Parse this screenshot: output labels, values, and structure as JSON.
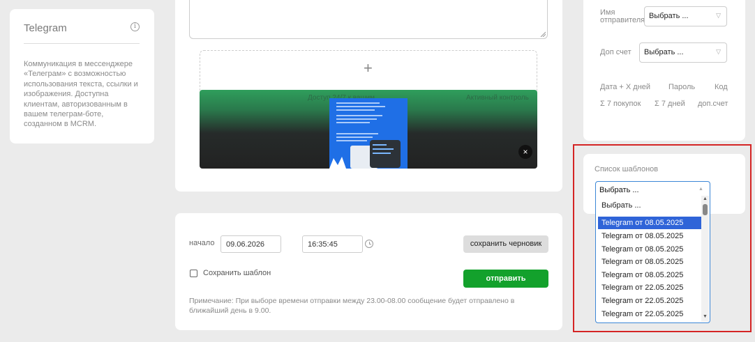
{
  "telegram_card": {
    "title": "Telegram",
    "description": "Коммуникация в мессенджере «Телеграм» с возможностью использования текста, ссылки и изображения. Доступна клиентам, авторизованным в вашем телеграм-боте, созданном в MCRM."
  },
  "composer": {
    "upload_plus": "+",
    "preview_caption_left": "Доступ 24/7 к вашим",
    "preview_caption_right": "Активный контроль",
    "close_symbol": "×"
  },
  "send_panel": {
    "start_label": "начало",
    "start_date": "09.06.2026",
    "start_time": "16:35:45",
    "save_draft_label": "сохранить черновик",
    "save_template_label": "Сохранить шаблон",
    "send_label": "отправить",
    "note": "Примечание: При выборе времени отправки между 23.00-08.00 сообщение будет отправлено в ближайший день в 9.00."
  },
  "fields": {
    "sender_label": "Имя отправителя",
    "sender_value": "Выбрать ...",
    "extra_account_label": "Доп счет",
    "extra_account_value": "Выбрать ...",
    "variables": [
      "Дата + X дней",
      "Пароль",
      "Код",
      "Σ 7 покупок",
      "Σ 7 дней",
      "доп.счет"
    ]
  },
  "templates": {
    "label": "Список шаблонов",
    "selected": "Выбрать ...",
    "options": [
      "Выбрать ...",
      "Telegram от 08.05.2025",
      "Telegram от 08.05.2025",
      "Telegram от 08.05.2025",
      "Telegram от 08.05.2025",
      "Telegram от 08.05.2025",
      "Telegram от 22.05.2025",
      "Telegram от 22.05.2025",
      "Telegram от 22.05.2025"
    ],
    "highlighted_index": 1
  },
  "colors": {
    "accent_green": "#13a12c",
    "highlight_red": "#d42424",
    "selection_blue": "#2f64d8"
  }
}
